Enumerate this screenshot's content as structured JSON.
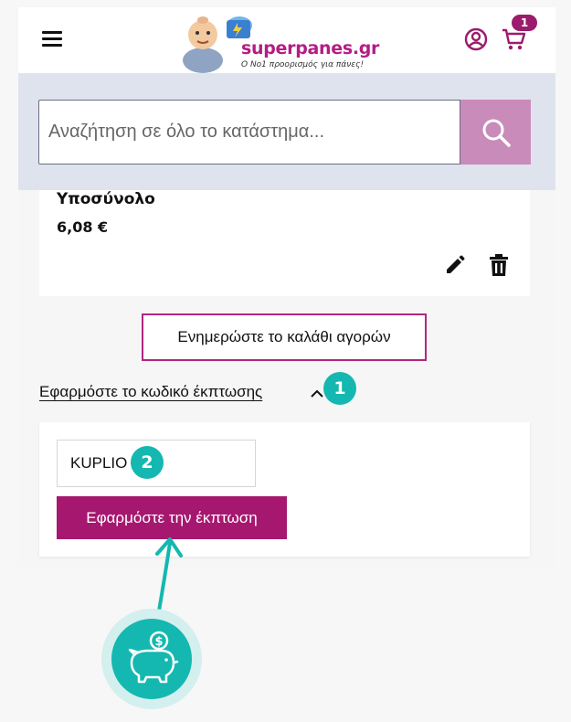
{
  "header": {
    "logo": {
      "brand": "superpanes.gr",
      "tagline": "Ο Νο1 προορισμός για πάνες!"
    },
    "cart_count": "1"
  },
  "search": {
    "placeholder": "Αναζήτηση σε όλο το κατάστημα..."
  },
  "summary": {
    "subtotal_label": "Υποσύνολο",
    "subtotal_value": "6,08 €"
  },
  "cart_actions": {
    "update_label": "Ενημερώστε το καλάθι αγορών"
  },
  "discount": {
    "toggle_label": "Εφαρμόστε το κωδικό έκπτωσης",
    "code_value": "KUPLIO",
    "apply_label": "Εφαρμόστε την έκπτωση"
  },
  "annotations": {
    "step1": "1",
    "step2": "2"
  },
  "colors": {
    "accent": "#a6186f",
    "teal": "#14b8b0",
    "search_band": "#dfe3ee"
  },
  "icons": [
    "menu-icon",
    "user-icon",
    "cart-icon",
    "search-icon",
    "edit-icon",
    "trash-icon",
    "chevron-up-icon",
    "piggy-bank-icon"
  ]
}
